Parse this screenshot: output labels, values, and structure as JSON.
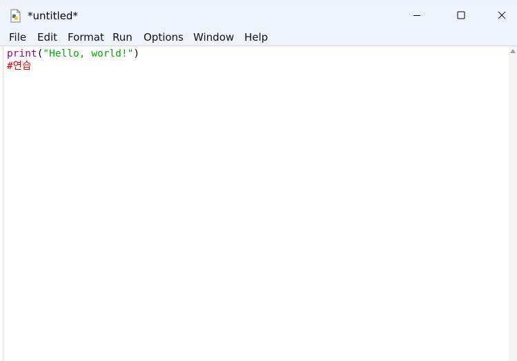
{
  "window": {
    "title": "*untitled*",
    "icon": "python-idle-icon"
  },
  "controls": {
    "minimize": "minimize-icon",
    "maximize": "maximize-icon",
    "close": "close-icon"
  },
  "menu": {
    "items": [
      "File",
      "Edit",
      "Format",
      "Run",
      "Options",
      "Window",
      "Help"
    ]
  },
  "editor": {
    "line1": {
      "keyword": "print",
      "open": "(",
      "string": "\"Hello, world!\"",
      "close": ")"
    },
    "line2": {
      "comment": "#연습"
    }
  },
  "colors": {
    "keyword": "#900090",
    "string": "#00aa00",
    "comment": "#dd0000",
    "titlebar": "#eef4fb"
  }
}
